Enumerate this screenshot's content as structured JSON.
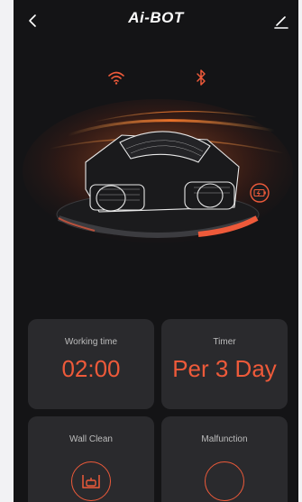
{
  "header": {
    "brand": "Ai-BOT"
  },
  "status": {
    "wifi_connected": true,
    "bluetooth_connected": true
  },
  "cards": {
    "working_time": {
      "label": "Working time",
      "value": "02:00"
    },
    "timer": {
      "label": "Timer",
      "value": "Per 3 Day"
    },
    "wall_clean": {
      "label": "Wall Clean"
    },
    "malfunction": {
      "label": "Malfunction"
    }
  },
  "colors": {
    "accent": "#ee5a3a",
    "background": "#141416",
    "card": "#2a2a2d"
  },
  "icons": {
    "back": "chevron-left-icon",
    "edit": "edit-icon",
    "wifi": "wifi-icon",
    "bluetooth": "bluetooth-icon",
    "battery": "battery-icon",
    "wall": "wall-clean-icon"
  }
}
